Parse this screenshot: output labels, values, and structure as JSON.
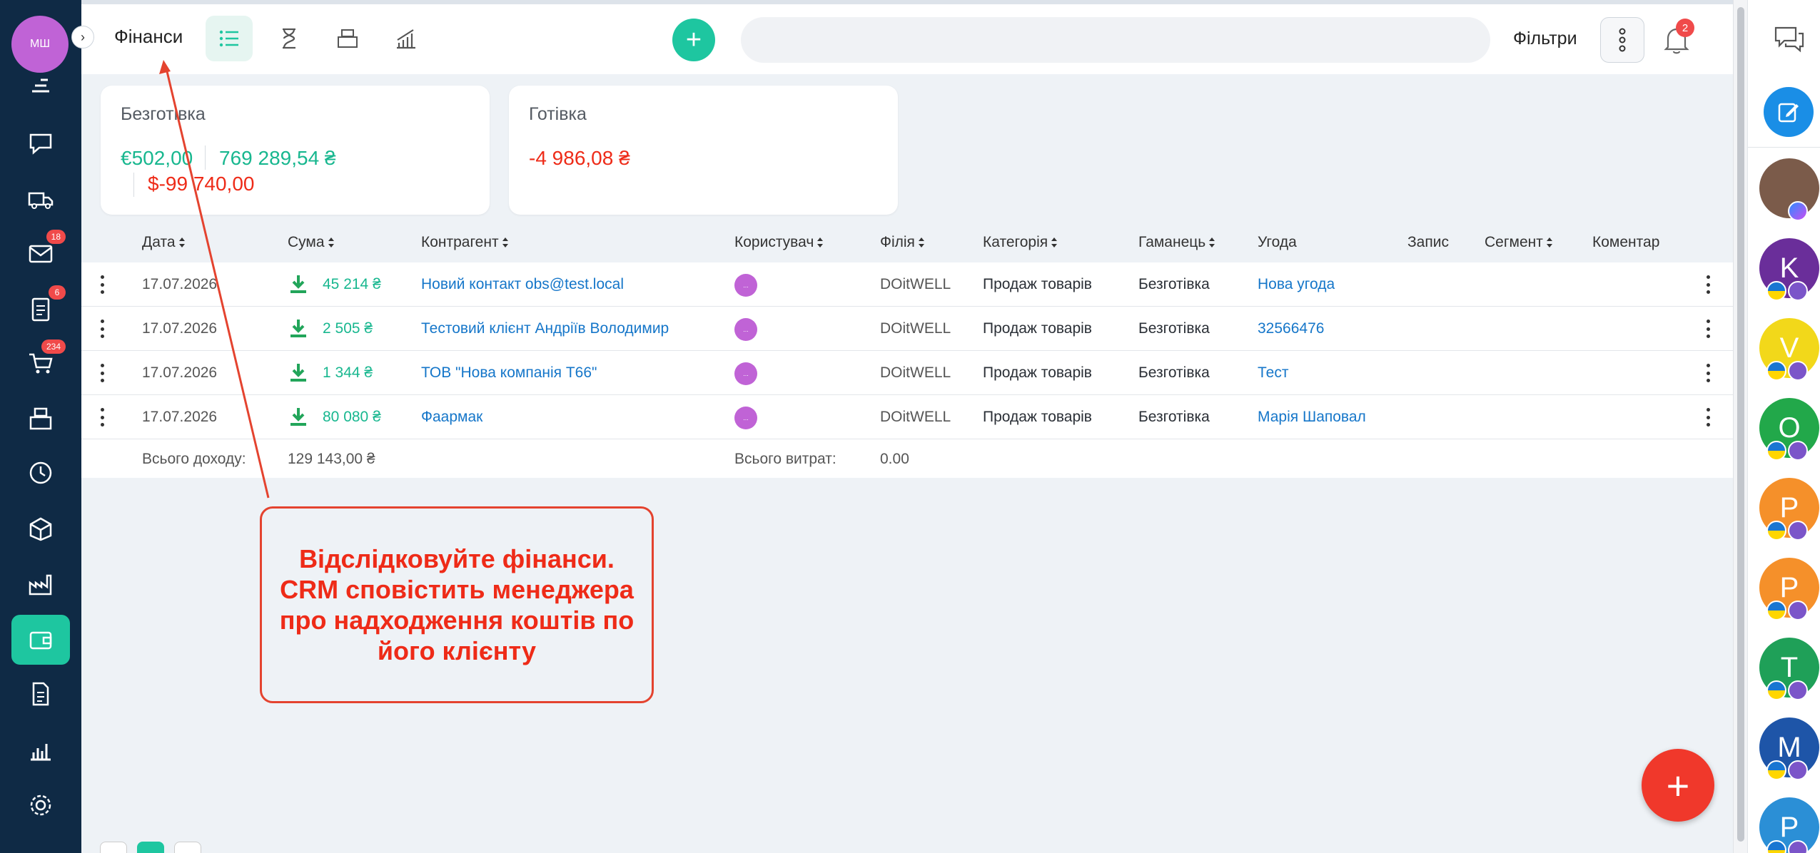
{
  "user": {
    "initials": "МШ"
  },
  "sidebar": {
    "badges": {
      "mail": "18",
      "tasks": "6",
      "orders": "234"
    }
  },
  "header": {
    "title": "Фінанси",
    "search_placeholder": "",
    "filters_label": "Фільтри",
    "notifications_count": "2"
  },
  "cards": {
    "cashless": {
      "title": "Безготівка",
      "eur": "€502,00",
      "uah": "769 289,54 ₴",
      "usd": "$-99 740,00"
    },
    "cash": {
      "title": "Готівка",
      "uah": "-4 986,08 ₴"
    }
  },
  "table": {
    "columns": [
      "Дата",
      "Сума",
      "Контрагент",
      "Користувач",
      "Філія",
      "Категорія",
      "Гаманець",
      "Угода",
      "Запис",
      "Сегмент",
      "Коментар"
    ],
    "rows": [
      {
        "date": "17.07.2026",
        "amount": "45 214 ₴",
        "counterparty": "Новий контакт obs@test.local",
        "user": "...",
        "branch": "DOitWELL",
        "category": "Продаж товарів",
        "wallet": "Безготівка",
        "deal": "Нова угода"
      },
      {
        "date": "17.07.2026",
        "amount": "2 505 ₴",
        "counterparty": "Тестовий клієнт Андріїв Володимир",
        "user": "...",
        "branch": "DOitWELL",
        "category": "Продаж товарів",
        "wallet": "Безготівка",
        "deal": "32566476"
      },
      {
        "date": "17.07.2026",
        "amount": "1 344 ₴",
        "counterparty": "ТОВ \"Нова компанія Т66\"",
        "user": "...",
        "branch": "DOitWELL",
        "category": "Продаж товарів",
        "wallet": "Безготівка",
        "deal": "Тест"
      },
      {
        "date": "17.07.2026",
        "amount": "80 080 ₴",
        "counterparty": "Фаармак",
        "user": "...",
        "branch": "DOitWELL",
        "category": "Продаж товарів",
        "wallet": "Безготівка",
        "deal": "Марія Шаповал"
      }
    ],
    "summary": {
      "income_label": "Всього доходу:",
      "income_value": "129 143,00 ₴",
      "expense_label": "Всього витрат:",
      "expense_value": "0.00"
    }
  },
  "annotation": {
    "text": "Відслідковуйте фінанси. CRM сповістить менеджера про надходження коштів по його клієнту"
  },
  "right_rail": {
    "avatars": [
      {
        "letter": "",
        "color": "#7b5b4a",
        "channel": "messenger"
      },
      {
        "letter": "K",
        "color": "#6a2e9a",
        "channel": "viber"
      },
      {
        "letter": "V",
        "color": "#f2d81a",
        "channel": "viber"
      },
      {
        "letter": "O",
        "color": "#22a84a",
        "channel": "viber"
      },
      {
        "letter": "P",
        "color": "#f5902a",
        "channel": "viber"
      },
      {
        "letter": "P",
        "color": "#f5902a",
        "channel": "viber"
      },
      {
        "letter": "T",
        "color": "#1fa058",
        "channel": "viber"
      },
      {
        "letter": "M",
        "color": "#1e55a8",
        "channel": "viber"
      },
      {
        "letter": "P",
        "color": "#2b8fd6",
        "channel": "viber"
      }
    ]
  },
  "colors": {
    "accent": "#1ec6a0",
    "sidebar": "#0f2a45",
    "danger": "#ee2b18",
    "link": "#1576c9"
  }
}
